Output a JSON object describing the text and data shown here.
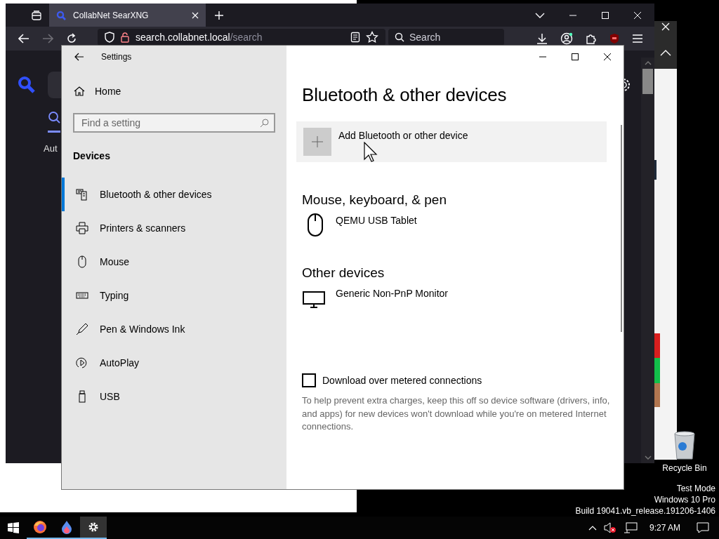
{
  "browser": {
    "tab": {
      "title": "CollabNet SearXNG",
      "selected": true
    },
    "url_host": "search.collabnet.local",
    "url_path": "/search",
    "search": {
      "placeholder": "Search"
    },
    "page": {
      "link": "Aut"
    }
  },
  "settings": {
    "title": "Settings",
    "home": "Home",
    "search": {
      "placeholder": "Find a setting"
    },
    "section": "Devices",
    "nav": [
      {
        "label": "Bluetooth & other devices",
        "kind": "bluetooth",
        "selected": true
      },
      {
        "label": "Printers & scanners",
        "kind": "printer",
        "selected": false
      },
      {
        "label": "Mouse",
        "kind": "mouse",
        "selected": false
      },
      {
        "label": "Typing",
        "kind": "keyboard",
        "selected": false
      },
      {
        "label": "Pen & Windows Ink",
        "kind": "pen",
        "selected": false
      },
      {
        "label": "AutoPlay",
        "kind": "autoplay",
        "selected": false
      },
      {
        "label": "USB",
        "kind": "usb",
        "selected": false
      }
    ],
    "heading": "Bluetooth & other devices",
    "add_button": "Add Bluetooth or other device",
    "groups": [
      {
        "title": "Mouse, keyboard, & pen",
        "devices": [
          {
            "name": "QEMU USB Tablet",
            "kind": "mouse"
          }
        ]
      },
      {
        "title": "Other devices",
        "devices": [
          {
            "name": "Generic Non-PnP Monitor",
            "kind": "monitor"
          }
        ]
      }
    ],
    "metered": {
      "label": "Download over metered connections",
      "checked": false,
      "description": "To help prevent extra charges, keep this off so device software (drivers, info, and apps) for new devices won't download while you're on metered Internet connections."
    }
  },
  "desktop_icons": [
    {
      "label": "Recycle Bin"
    }
  ],
  "os_notice": [
    "Test Mode",
    "Windows 10 Pro",
    "Build 19041.vb_release.191206-1406"
  ],
  "taskbar": {
    "apps": [
      {
        "kind": "firefox",
        "selected": false
      },
      {
        "kind": "drop",
        "selected": false
      },
      {
        "kind": "settings",
        "selected": true
      }
    ],
    "volume_muted": true,
    "time": "9:27 AM"
  }
}
